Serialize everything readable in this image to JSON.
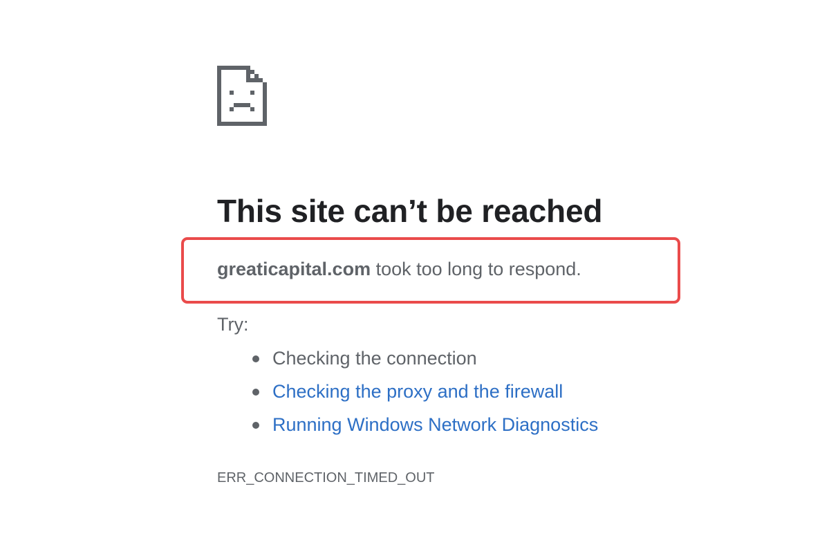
{
  "icon": "sad-page-icon",
  "headline": "This site can’t be reached",
  "message": {
    "host": "greaticapital.com",
    "text": " took too long to respond."
  },
  "try_label": "Try:",
  "suggestions": [
    {
      "label": "Checking the connection",
      "link": false
    },
    {
      "label": "Checking the proxy and the firewall",
      "link": true
    },
    {
      "label": "Running Windows Network Diagnostics",
      "link": true
    }
  ],
  "error_code": "ERR_CONNECTION_TIMED_OUT",
  "colors": {
    "text": "#5f6368",
    "heading": "#202124",
    "link": "#2d6fc5",
    "highlight": "#ea4b4b"
  }
}
